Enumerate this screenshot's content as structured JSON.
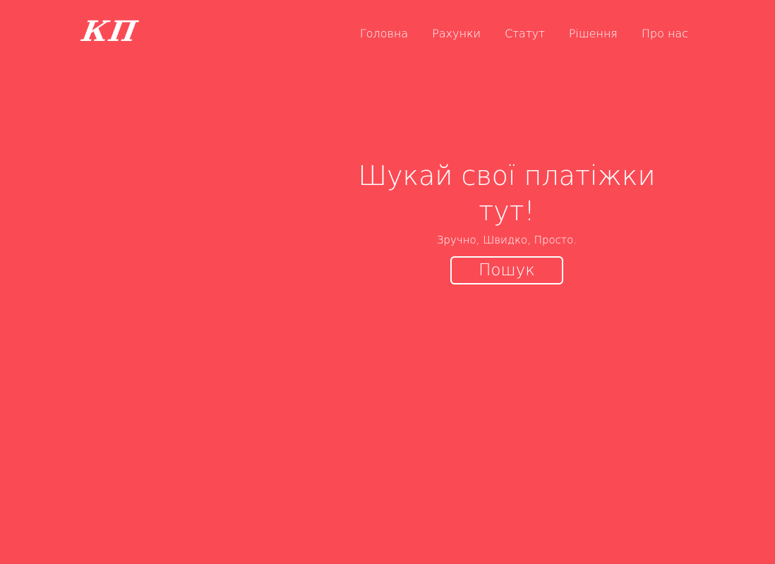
{
  "header": {
    "logo_text": "КП",
    "nav": {
      "items": [
        {
          "label": "Головна"
        },
        {
          "label": "Рахунки"
        },
        {
          "label": "Статут"
        },
        {
          "label": "Рішення"
        },
        {
          "label": "Про нас"
        }
      ]
    }
  },
  "hero": {
    "title": "Шукай свої платіжки тут!",
    "subtitle": "Зручно, Швидко, Просто.",
    "button_label": "Пошук"
  },
  "colors": {
    "background": "#fa4b55",
    "text": "#ffffff"
  }
}
